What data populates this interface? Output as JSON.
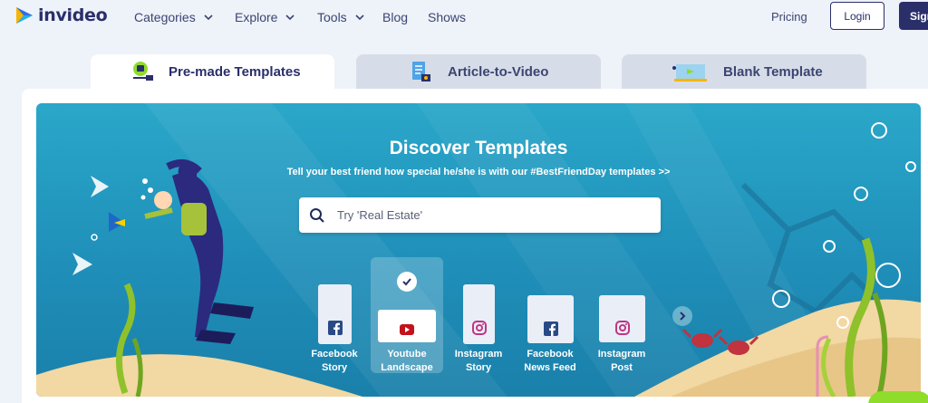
{
  "brand": {
    "name": "invideo"
  },
  "nav": {
    "items": [
      {
        "label": "Categories",
        "dropdown": true
      },
      {
        "label": "Explore",
        "dropdown": true
      },
      {
        "label": "Tools",
        "dropdown": true
      },
      {
        "label": "Blog",
        "dropdown": false
      },
      {
        "label": "Shows",
        "dropdown": false
      }
    ],
    "pricing": "Pricing",
    "login": "Login",
    "signup": "Sign"
  },
  "tabs": [
    {
      "label": "Pre-made Templates",
      "active": true,
      "icon": "laptop-play-icon"
    },
    {
      "label": "Article-to-Video",
      "active": false,
      "icon": "article-icon"
    },
    {
      "label": "Blank Template",
      "active": false,
      "icon": "blank-canvas-icon"
    }
  ],
  "hero": {
    "title": "Discover Templates",
    "subtitle": "Tell your best friend how special he/she is with our #BestFriendDay templates >>"
  },
  "search": {
    "placeholder": "Try 'Real Estate'"
  },
  "formats": [
    {
      "line1": "Facebook",
      "line2": "Story",
      "icon": "facebook-icon",
      "selected": false
    },
    {
      "line1": "Youtube",
      "line2": "Landscape",
      "icon": "youtube-icon",
      "selected": true
    },
    {
      "line1": "Instagram",
      "line2": "Story",
      "icon": "instagram-icon",
      "selected": false
    },
    {
      "line1": "Facebook",
      "line2": "News Feed",
      "icon": "facebook-icon",
      "selected": false
    },
    {
      "line1": "Instagram",
      "line2": "Post",
      "icon": "instagram-icon",
      "selected": false
    }
  ],
  "colors": {
    "brand_navy": "#2a2f6a",
    "ocean": "#1f8fb9",
    "facebook": "#2a4a86",
    "youtube": "#c4121a",
    "instagram": "#c13584"
  }
}
